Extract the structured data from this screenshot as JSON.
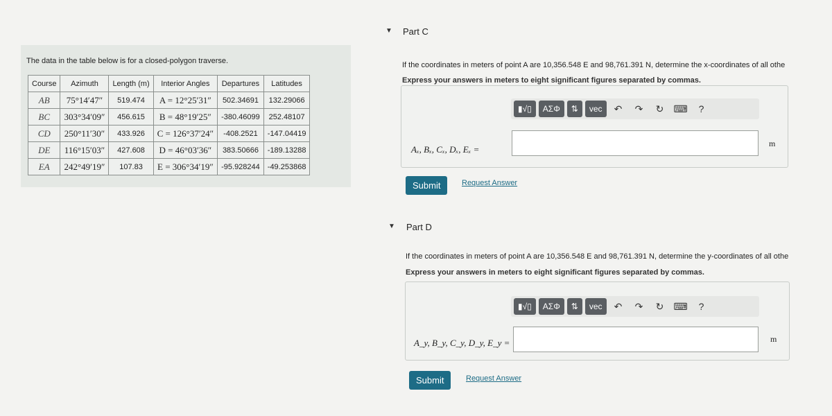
{
  "left": {
    "intro": "The data in the table below is for a closed-polygon traverse.",
    "headers": [
      "Course",
      "Azimuth",
      "Length (m)",
      "Interior Angles",
      "Departures",
      "Latitudes"
    ],
    "rows": [
      [
        "AB",
        "75°14′47″",
        "519.474",
        "A = 12°25′31″",
        "502.34691",
        "132.29066"
      ],
      [
        "BC",
        "303°34′09″",
        "456.615",
        "B = 48°19′25″",
        "-380.46099",
        "252.48107"
      ],
      [
        "CD",
        "250°11′30″",
        "433.926",
        "C = 126°37′24″",
        "-408.2521",
        "-147.04419"
      ],
      [
        "DE",
        "116°15′03″",
        "427.608",
        "D = 46°03′36″",
        "383.50666",
        "-189.13288"
      ],
      [
        "EA",
        "242°49′19″",
        "107.83",
        "E = 306°34′19″",
        "-95.928244",
        "-49.253868"
      ]
    ]
  },
  "toolbar": {
    "templates": "▮√▯",
    "greek": "ΑΣΦ",
    "arrows": "⇅",
    "vec": "vec",
    "undo": "↶",
    "redo": "↷",
    "reset": "↻",
    "keyboard": "⌨",
    "help": "?"
  },
  "partC": {
    "title": "Part C",
    "question": "If the coordinates in meters of point A are 10,356.548 E and 98,761.391 N, determine the x-coordinates of all othe",
    "instruction": "Express your answers in meters to eight significant figures separated by commas.",
    "label": "Aₓ, Bₓ, Cₓ, Dₓ, Eₓ =",
    "value": "",
    "unit": "m",
    "submit": "Submit",
    "request": "Request Answer"
  },
  "partD": {
    "title": "Part D",
    "question": "If the coordinates in meters of point A are 10,356.548 E and 98,761.391 N, determine the y-coordinates of all othe",
    "instruction": "Express your answers in meters to eight significant figures separated by commas.",
    "label": "A_y, B_y, C_y, D_y, E_y =",
    "value": "",
    "unit": "m",
    "submit": "Submit",
    "request": "Request Answer"
  },
  "colors": {
    "accent": "#1d6c86",
    "toolbar_button": "#5a5e62"
  }
}
